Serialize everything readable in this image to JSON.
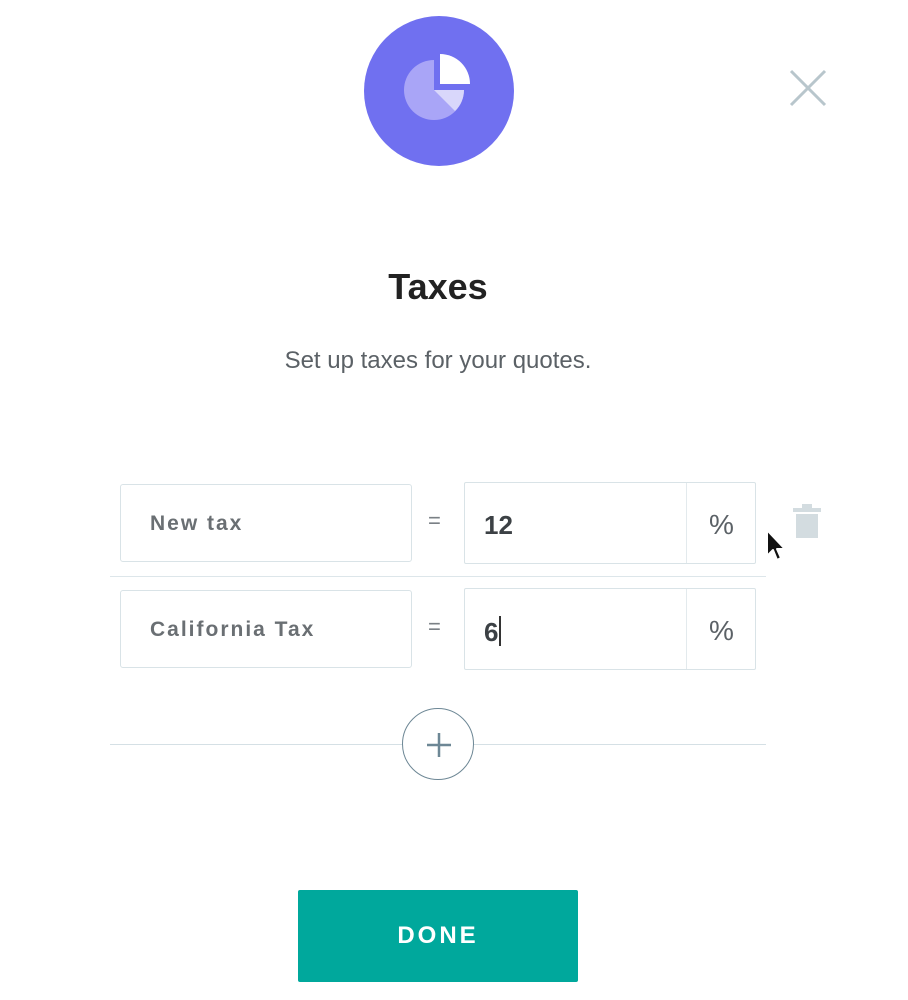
{
  "header": {
    "icon": "pie-chart-icon",
    "accent_color": "#7070f0",
    "close_icon": "close-icon",
    "title": "Taxes",
    "subtitle": "Set up taxes for your quotes."
  },
  "taxes": [
    {
      "name": "New tax",
      "equals": "=",
      "rate": "12",
      "unit": "%",
      "show_delete": true
    },
    {
      "name": "California Tax",
      "equals": "=",
      "rate": "6",
      "unit": "%",
      "editing": true
    }
  ],
  "add_icon": "plus-icon",
  "delete_icon": "trash-icon",
  "done_button": {
    "label": "DONE",
    "color": "#00a89c"
  }
}
